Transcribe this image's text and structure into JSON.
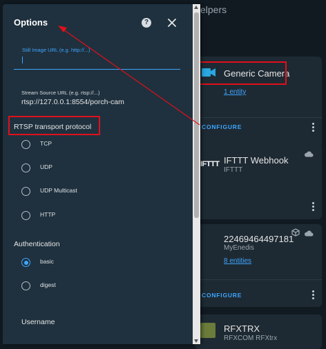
{
  "background": {
    "header_partial": "elpers",
    "cards": [
      {
        "title": "Generic Camera",
        "link": "1 entity",
        "configure": "CONFIGURE"
      },
      {
        "title": "IFTTT Webhook",
        "subtitle": "IFTTT",
        "logo_text": "IFTTT"
      },
      {
        "title": "22469464497181",
        "subtitle": "MyEnedis",
        "link": "8 entities",
        "configure": "CONFIGURE"
      },
      {
        "title": "RFXTRX",
        "subtitle": "RFXCOM RFXtrx"
      }
    ]
  },
  "dialog": {
    "title": "Options",
    "still_image": {
      "placeholder": "Still Image URL (e.g. http://...)",
      "value": ""
    },
    "stream_source": {
      "label": "Stream Source URL (e.g. rtsp://...)",
      "value": "rtsp://127.0.0.1:8554/porch-cam"
    },
    "rtsp": {
      "label": "RTSP transport protocol",
      "options": [
        {
          "label": "TCP",
          "checked": false
        },
        {
          "label": "UDP",
          "checked": false
        },
        {
          "label": "UDP Multicast",
          "checked": false
        },
        {
          "label": "HTTP",
          "checked": false
        }
      ]
    },
    "authentication": {
      "label": "Authentication",
      "options": [
        {
          "label": "basic",
          "checked": true
        },
        {
          "label": "digest",
          "checked": false
        }
      ]
    },
    "username_label": "Username"
  },
  "colors": {
    "accent": "#3ea6ff",
    "annotation": "#e0101a",
    "dialog_bg": "#1f313e",
    "page_bg": "#111a21"
  }
}
